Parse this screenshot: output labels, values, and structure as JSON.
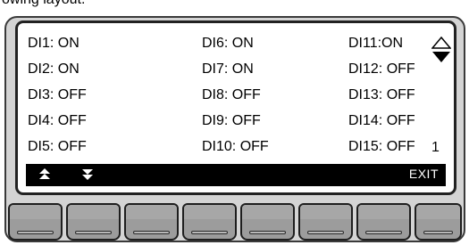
{
  "caption": "owing layout.",
  "di_points": [
    {
      "label": "DI1: ON"
    },
    {
      "label": "DI2: ON"
    },
    {
      "label": "DI3: OFF"
    },
    {
      "label": "DI4: OFF"
    },
    {
      "label": "DI5: OFF"
    },
    {
      "label": "DI6: ON"
    },
    {
      "label": "DI7: ON"
    },
    {
      "label": "DI8: OFF"
    },
    {
      "label": "DI9: OFF"
    },
    {
      "label": "DI10: OFF"
    },
    {
      "label": "DI11:ON"
    },
    {
      "label": "DI12: OFF"
    },
    {
      "label": "DI13: OFF"
    },
    {
      "label": "DI14: OFF"
    },
    {
      "label": "DI15: OFF"
    }
  ],
  "page_number": "1",
  "softkeys": {
    "up_icon": "double-up-arrow-icon",
    "down_icon": "double-down-arrow-icon",
    "exit_label": "EXIT"
  },
  "scroll_icon": "up-down-scroll-arrows-icon",
  "function_keys": 8,
  "colors": {
    "screen_bg": "#ffffff",
    "bezel": "#d4d4d4",
    "softkey_bar": "#000000",
    "key_face": "#9c9c9c"
  }
}
